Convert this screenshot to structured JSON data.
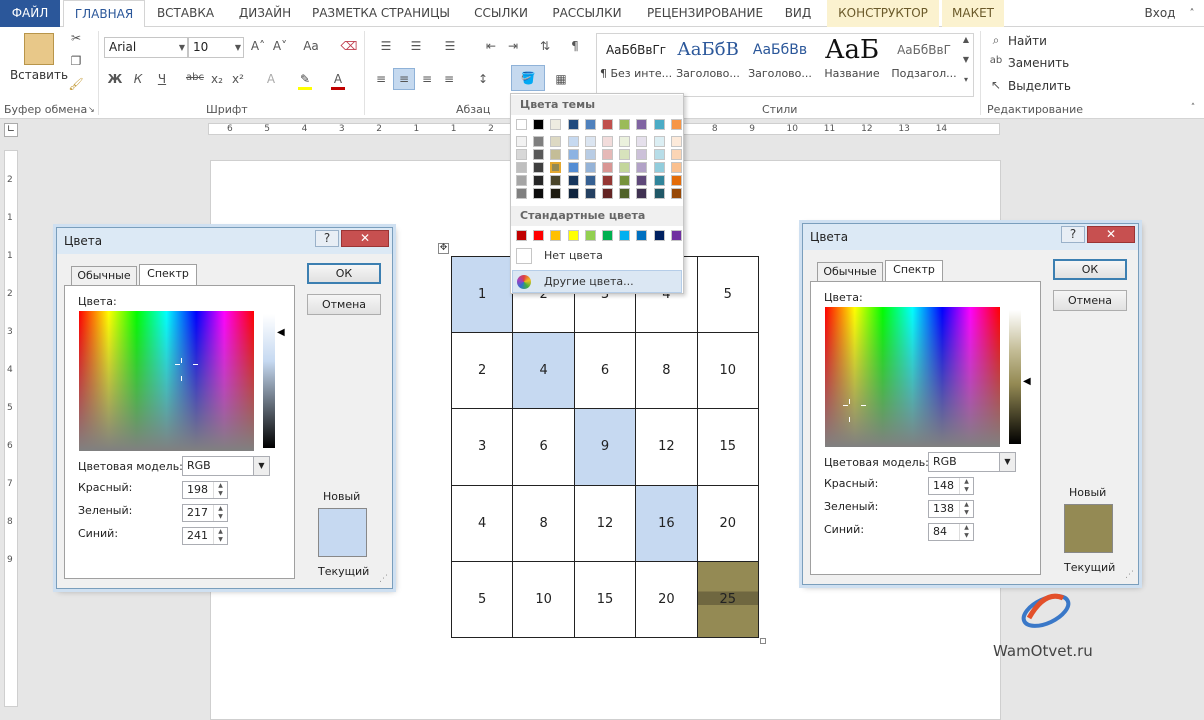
{
  "tabs": {
    "file": "ФАЙЛ",
    "home": "ГЛАВНАЯ",
    "insert": "ВСТАВКА",
    "design": "ДИЗАЙН",
    "layout": "РАЗМЕТКА СТРАНИЦЫ",
    "refs": "ССЫЛКИ",
    "mailings": "РАССЫЛКИ",
    "review": "РЕЦЕНЗИРОВАНИЕ",
    "view": "ВИД",
    "constructor": "КОНСТРУКТОР",
    "maket": "МАКЕТ",
    "signin": "Вход"
  },
  "ribbon": {
    "paste": "Вставить",
    "clipboard": "Буфер обмена",
    "font_group": "Шрифт",
    "font_name": "Arial",
    "font_size": "10",
    "paragraph": "Абзац",
    "styles_group": "Стили",
    "editing_group": "Редактирование",
    "find": "Найти",
    "replace": "Заменить",
    "select": "Выделить",
    "styles": [
      {
        "sample": "АаБбВвГг",
        "name": "¶ Без инте..."
      },
      {
        "sample": "АаБбВ",
        "name": "Заголово..."
      },
      {
        "sample": "АаБбВв",
        "name": "Заголово..."
      },
      {
        "sample": "АаБ",
        "name": "Название"
      },
      {
        "sample": "АаБбВвГ",
        "name": "Подзагол..."
      }
    ],
    "bold": "Ж",
    "italic": "К",
    "underline": "Ч",
    "strike": "abc",
    "sub": "x₂",
    "sup": "x²",
    "grow": "A˄",
    "shrink": "A˅",
    "case": "Aa"
  },
  "ruler": {
    "h_ticks": [
      "6",
      "5",
      "4",
      "3",
      "2",
      "1",
      "1",
      "2",
      "3",
      "4",
      "5",
      "6",
      "7",
      "8",
      "9",
      "10",
      "11",
      "12",
      "13",
      "14"
    ],
    "v_ticks": [
      "2",
      "1",
      "1",
      "2",
      "3",
      "4",
      "5",
      "6",
      "7",
      "8",
      "9"
    ]
  },
  "table": {
    "rows": [
      [
        "1",
        "2",
        "3",
        "4",
        "5"
      ],
      [
        "2",
        "4",
        "6",
        "8",
        "10"
      ],
      [
        "3",
        "6",
        "9",
        "12",
        "15"
      ],
      [
        "4",
        "8",
        "12",
        "16",
        "20"
      ],
      [
        "5",
        "10",
        "15",
        "20",
        "25"
      ]
    ]
  },
  "dropdown": {
    "theme_title": "Цвета темы",
    "standard_title": "Стандартные цвета",
    "no_color": "Нет цвета",
    "more_colors": "Другие цвета...",
    "theme_top": [
      "#ffffff",
      "#000000",
      "#eeece1",
      "#1f497d",
      "#4f81bd",
      "#c0504d",
      "#9bbb59",
      "#8064a2",
      "#4bacc6",
      "#f79646"
    ],
    "theme_shades": [
      [
        "#f2f2f2",
        "#7f7f7f",
        "#ddd9c3",
        "#c6d9f0",
        "#dbe5f1",
        "#f2dcdb",
        "#ebf1dd",
        "#e5e0ec",
        "#dbeef3",
        "#fdeada"
      ],
      [
        "#d8d8d8",
        "#595959",
        "#c4bd97",
        "#8db3e2",
        "#b8cce4",
        "#e5b9b7",
        "#d7e3bc",
        "#ccc1d9",
        "#b7dde8",
        "#fbd5b5"
      ],
      [
        "#bfbfbf",
        "#3f3f3f",
        "#948a54",
        "#548dd4",
        "#95b3d7",
        "#d99694",
        "#c3d69b",
        "#b2a2c7",
        "#92cddc",
        "#fac08f"
      ],
      [
        "#a5a5a5",
        "#262626",
        "#4a452a",
        "#17365d",
        "#366092",
        "#953734",
        "#76923c",
        "#5f497a",
        "#31859b",
        "#e36c09"
      ],
      [
        "#7f7f7f",
        "#0c0c0c",
        "#1d1b10",
        "#0f243e",
        "#244061",
        "#632423",
        "#4f6128",
        "#3f3151",
        "#205867",
        "#974806"
      ]
    ],
    "standard": [
      "#c00000",
      "#ff0000",
      "#ffc000",
      "#ffff00",
      "#92d050",
      "#00b050",
      "#00b0f0",
      "#0070c0",
      "#002060",
      "#7030a0"
    ]
  },
  "dialog_left": {
    "title": "Цвета",
    "tab_standard": "Обычные",
    "tab_custom": "Спектр",
    "colors_label": "Цвета:",
    "model_label": "Цветовая модель:",
    "model_value": "RGB",
    "red_label": "Красный:",
    "green_label": "Зеленый:",
    "blue_label": "Синий:",
    "red": "198",
    "green": "217",
    "blue": "241",
    "ok": "ОК",
    "cancel": "Отмена",
    "new": "Новый",
    "current": "Текущий",
    "color": "#c6d9f1"
  },
  "dialog_right": {
    "title": "Цвета",
    "tab_standard": "Обычные",
    "tab_custom": "Спектр",
    "colors_label": "Цвета:",
    "model_label": "Цветовая модель:",
    "model_value": "RGB",
    "red_label": "Красный:",
    "green_label": "Зеленый:",
    "blue_label": "Синий:",
    "red": "148",
    "green": "138",
    "blue": "84",
    "ok": "ОК",
    "cancel": "Отмена",
    "new": "Новый",
    "current": "Текущий",
    "color": "#948a54"
  },
  "watermark": "WamOtvet.ru"
}
